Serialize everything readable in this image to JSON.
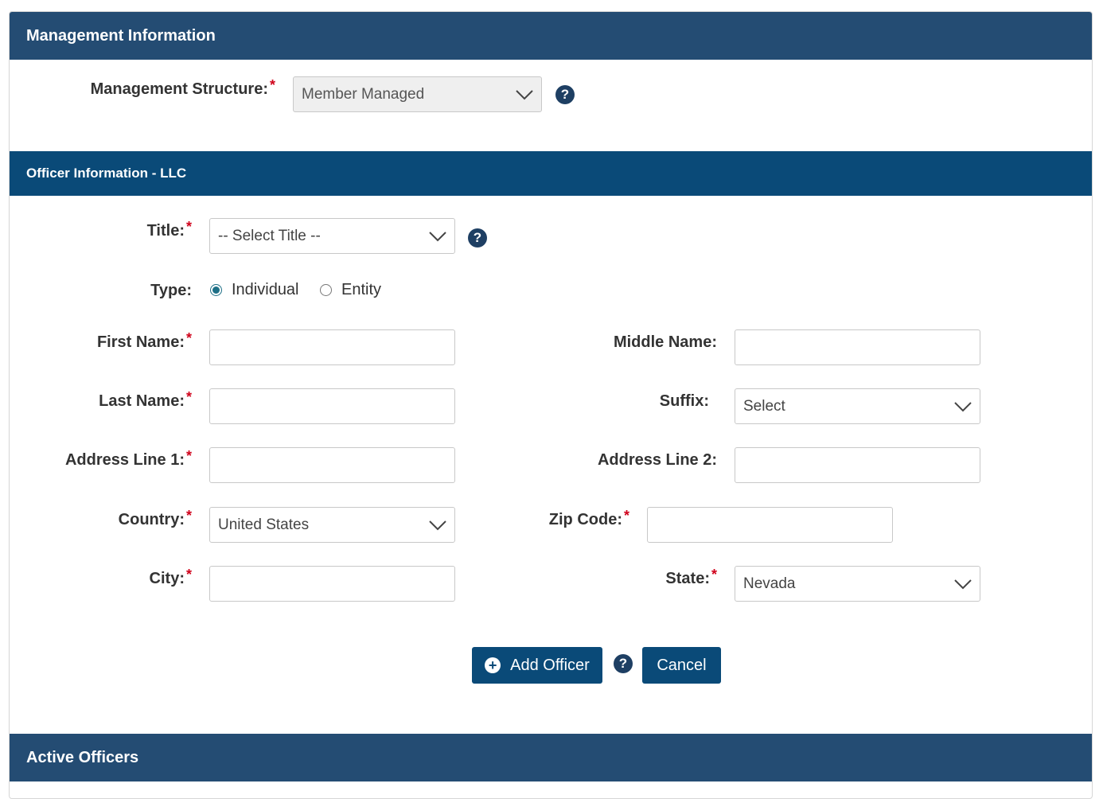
{
  "management": {
    "header": "Management Information",
    "structure_label": "Management Structure:",
    "structure_value": "Member Managed"
  },
  "officer": {
    "header": "Officer Information - LLC",
    "title_label": "Title:",
    "title_value": "-- Select Title --",
    "type_label": "Type:",
    "type_individual": "Individual",
    "type_entity": "Entity",
    "first_name_label": "First Name:",
    "middle_name_label": "Middle Name:",
    "last_name_label": "Last Name:",
    "suffix_label": "Suffix:",
    "suffix_value": "Select",
    "address1_label": "Address Line 1:",
    "address2_label": "Address Line 2:",
    "country_label": "Country:",
    "country_value": "United States",
    "zip_label": "Zip Code:",
    "city_label": "City:",
    "state_label": "State:",
    "state_value": "Nevada",
    "required_mark": "*",
    "help_glyph": "?"
  },
  "actions": {
    "add_label": "Add Officer",
    "cancel_label": "Cancel"
  },
  "active": {
    "header": "Active Officers"
  }
}
